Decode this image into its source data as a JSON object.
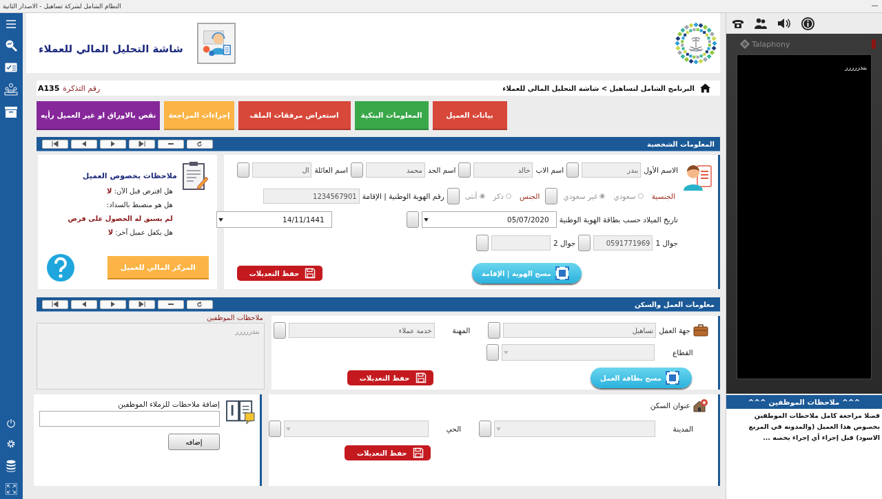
{
  "window": {
    "title": "النظام الشامل لشركة تساهيل - الاصدار الثانية"
  },
  "header": {
    "title": "شاشة التحليل المالي للعملاء"
  },
  "breadcrumb": {
    "path": "البرنامج الشامل لتساهيل > شاشة التحليل المالي للعملاء"
  },
  "ticket": {
    "label": "رقم التذكرة",
    "value": "A135"
  },
  "tabs": [
    {
      "label": "بيانات العميل",
      "color": "#d8483a"
    },
    {
      "label": "المعلومات البنكية",
      "color": "#39a849"
    },
    {
      "label": "استعراض مرفقات الملف",
      "color": "#d8483a"
    },
    {
      "label": "إجراءات المراجعة",
      "color": "#fbb445"
    },
    {
      "label": "نقص بالاوراق او غير العميل رأيه",
      "color": "#86289a"
    }
  ],
  "personal": {
    "title": "المعلومات الشخصية",
    "names": [
      {
        "label": "الاسم الأول",
        "value": "بندر"
      },
      {
        "label": "اسم الاب",
        "value": "خالد"
      },
      {
        "label": "اسم الجد",
        "value": "محمد"
      },
      {
        "label": "اسم العائلة",
        "value": "ال"
      }
    ],
    "nationality": {
      "label": "الجنسية",
      "options": [
        {
          "label": "سعودي",
          "selected": false
        },
        {
          "label": "غير سعودي",
          "selected": true
        }
      ]
    },
    "gender": {
      "label": "الجنس",
      "options": [
        {
          "label": "ذكر",
          "selected": false
        },
        {
          "label": "أنثى",
          "selected": true
        }
      ]
    },
    "id_number": {
      "label": "رقم الهوية الوطنية | الإقامة",
      "value": "1234567901"
    },
    "birth_date": {
      "label": "تاريخ الميلاد حسب بطاقة الهوية الوطنية",
      "gregorian": "05/07/2020",
      "hijri": "14/11/1441"
    },
    "mobiles": [
      {
        "label": "جوال 1",
        "value": "0591771969"
      },
      {
        "label": "جوال 2"
      }
    ],
    "scan_button": "مسح الهوية | الإقامة",
    "save_button": "حفظ التعديلات"
  },
  "client_notes": {
    "title": "ملاحظات بخصوص العميل",
    "questions": [
      {
        "question": "هل اقترض قبل الآن:",
        "answer": "لا",
        "kind": "inline"
      },
      {
        "question": "هل هو منضبط بالسداد:",
        "answer": "لم يسبق له الحصول على قرض",
        "kind": "below"
      },
      {
        "question": "هل يكفل عميل آخر:",
        "answer": "لا",
        "kind": "inline"
      }
    ],
    "button": "المركز المالي للعميل"
  },
  "work": {
    "title": "معلومات العمل والسكن",
    "employer": {
      "label": "جهة العمل",
      "value": "تساهيل"
    },
    "profession": {
      "label": "المهنة",
      "value": "خدمة عملاء"
    },
    "sector": {
      "label": "القطاع"
    },
    "scan_button": "مسح بطاقة العمل",
    "save_button": "حفظ التعديلات"
  },
  "staff_notes": {
    "title": "ملاحظات الموظفين",
    "text": "بندررررر"
  },
  "address": {
    "title": "عنوان السكن",
    "city": {
      "label": "المدينة"
    },
    "district": {
      "label": "الحي"
    },
    "save_button": "حفظ التعديلات"
  },
  "add_note": {
    "label": "إضافة ملاحظات للزملاء الموظفين",
    "button": "إضافه"
  },
  "phone": {
    "brand": "Talaphony",
    "screen_text": "بندررررر",
    "notes_title": "^^^ ملاحظات الموظفين ^^^",
    "notes_text": "فضلا مراجعة كامل ملاحظات الموظفين بخصوص هذا العميل (والمدونه في المربع الاسود) قبل إجراء أي إجراء يخصه ..."
  }
}
